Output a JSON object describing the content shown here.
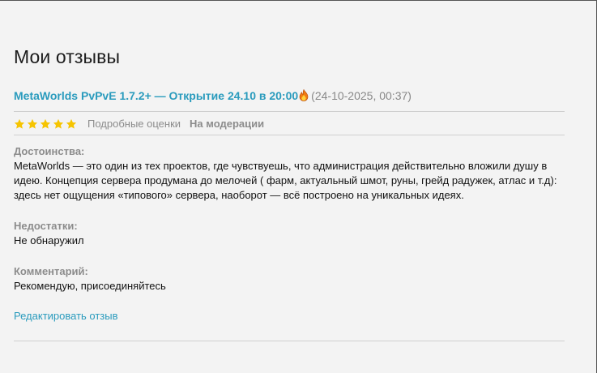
{
  "page": {
    "title": "Мои отзывы"
  },
  "review": {
    "server_name": "MetaWorlds PvPvE 1.7.2+ — Открытие 24.10 в 20:00",
    "date": "(24-10-2025, 00:37)",
    "rating_stars": 5,
    "rating_max": 5,
    "detailed_ratings_label": "Подробные оценки",
    "status": "На модерации",
    "pros_label": "Достоинства:",
    "pros_text": "MetaWorlds — это один из тех проектов, где чувствуешь, что администрация действительно вложили душу в идею. Концепция сервера продумана до мелочей ( фарм, актуальный шмот, руны, грейд радужек, атлас и т.д): здесь нет ощущения «типового» сервера, наоборот — всё построено на уникальных идеях.",
    "cons_label": "Недостатки:",
    "cons_text": "Не обнаружил",
    "comment_label": "Комментарий:",
    "comment_text": "Рекомендую, присоединяйтесь",
    "edit_label": "Редактировать отзыв"
  },
  "colors": {
    "link": "#2a9bbd",
    "star": "#f6c400",
    "muted": "#8c8c8c",
    "background": "#f3f3f3"
  },
  "icons": {
    "title_badge": "fire-icon",
    "rating": "star-icon"
  }
}
